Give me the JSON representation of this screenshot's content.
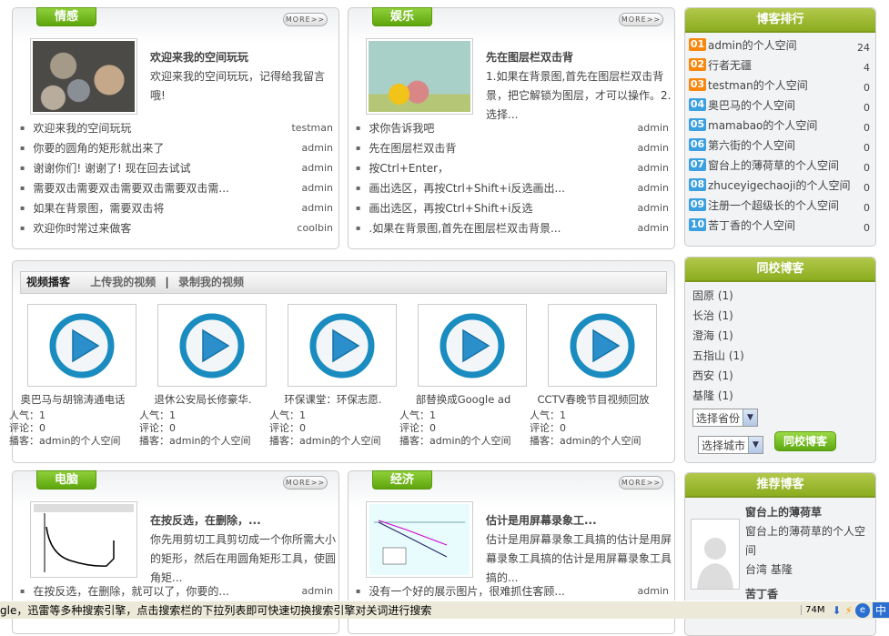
{
  "panels": [
    {
      "tab": "情感",
      "more": "MORE>>",
      "feature_title": "欢迎来我的空间玩玩",
      "feature_desc": "欢迎来我的空间玩玩，记得给我留言哦!",
      "items": [
        {
          "title": "欢迎来我的空间玩玩",
          "author": "testman"
        },
        {
          "title": "你要的圆角的矩形就出来了",
          "author": "admin"
        },
        {
          "title": "谢谢你们! 谢谢了! 现在回去试试",
          "author": "admin"
        },
        {
          "title": "需要双击需要双击需要双击需要双击需...",
          "author": "admin"
        },
        {
          "title": "如果在背景图，需要双击将",
          "author": "admin"
        },
        {
          "title": "欢迎你时常过来做客",
          "author": "coolbin"
        }
      ]
    },
    {
      "tab": "娱乐",
      "more": "MORE>>",
      "feature_title": "先在图层栏双击背",
      "feature_desc": "1.如果在背景图,首先在图层栏双击背景，把它解锁为图层，才可以操作。2.选择...",
      "items": [
        {
          "title": "求你告诉我吧",
          "author": "admin"
        },
        {
          "title": "先在图层栏双击背",
          "author": "admin"
        },
        {
          "title": "按Ctrl+Enter，",
          "author": "admin"
        },
        {
          "title": "画出选区，再按Ctrl+Shift+i反选画出...",
          "author": "admin"
        },
        {
          "title": "画出选区，再按Ctrl+Shift+i反选",
          "author": "admin"
        },
        {
          "title": ".如果在背景图,首先在图层栏双击背景...",
          "author": "admin"
        }
      ]
    },
    {
      "tab": "电脑",
      "more": "MORE>>",
      "feature_title": "在按反选，在删除，...",
      "feature_desc": "你先用剪切工具剪切成一个你所需大小的矩形，然后在用圆角矩形工具，使圆角矩...",
      "items": [
        {
          "title": "在按反选，在删除，就可以了，你要的...",
          "author": "admin"
        }
      ]
    },
    {
      "tab": "经济",
      "more": "MORE>>",
      "feature_title": "估计是用屏幕录象工...",
      "feature_desc": "估计是用屏幕录象工具搞的估计是用屏幕录象工具搞的估计是用屏幕录象工具搞的...",
      "items": [
        {
          "title": "没有一个好的展示图片，很难抓住客顾...",
          "author": "admin"
        }
      ]
    }
  ],
  "video": {
    "title": "视频播客",
    "upload": "上传我的视频",
    "sep": "|",
    "record": "录制我的视频",
    "items": [
      {
        "name": "奥巴马与胡锦涛通电话",
        "pop": "人气：1",
        "cmt": "评论：0",
        "author": "播客：admin的个人空间"
      },
      {
        "name": "退休公安局长修豪华.",
        "pop": "人气：1",
        "cmt": "评论：0",
        "author": "播客：admin的个人空间"
      },
      {
        "name": "环保课堂：环保志愿.",
        "pop": "人气：1",
        "cmt": "评论：0",
        "author": "播客：admin的个人空间"
      },
      {
        "name": "部替换成Google ad",
        "pop": "人气：1",
        "cmt": "评论：0",
        "author": "播客：admin的个人空间"
      },
      {
        "name": "CCTV春晚节目视频回放",
        "pop": "人气：1",
        "cmt": "评论：0",
        "author": "播客：admin的个人空间"
      }
    ]
  },
  "ranking": {
    "title": "博客排行",
    "items": [
      {
        "n": "01",
        "name": "admin的个人空间",
        "count": "24"
      },
      {
        "n": "02",
        "name": "行者无疆",
        "count": "4"
      },
      {
        "n": "03",
        "name": "testman的个人空间",
        "count": "0"
      },
      {
        "n": "04",
        "name": "奥巴马的个人空间",
        "count": "0"
      },
      {
        "n": "05",
        "name": "mamabao的个人空间",
        "count": "0"
      },
      {
        "n": "06",
        "name": "第六街的个人空间",
        "count": "0"
      },
      {
        "n": "07",
        "name": "窗台上的薄荷草的个人空间",
        "count": "0"
      },
      {
        "n": "08",
        "name": "zhuceyigechaoji的个人空间",
        "count": "0"
      },
      {
        "n": "09",
        "name": "注册一个超级长的个人空间",
        "count": "0"
      },
      {
        "n": "10",
        "name": "苦丁香的个人空间",
        "count": "0"
      }
    ]
  },
  "school": {
    "title": "同校博客",
    "items": [
      "固原 (1)",
      "长治 (1)",
      "澄海 (1)",
      "五指山 (1)",
      "西安 (1)",
      "基隆 (1)"
    ],
    "province": "选择省份",
    "city": "选择城市",
    "button": "同校博客"
  },
  "recommend": {
    "title": "推荐博客",
    "users": [
      {
        "name": "窗台上的薄荷草",
        "space": "窗台上的薄荷草的个人空间",
        "location": "台湾  基隆"
      },
      {
        "name": "苦丁香"
      }
    ]
  },
  "statusbar": {
    "text": "gle，迅雷等多种搜索引擎，点击搜索栏的下拉列表即可快速切换搜索引擎对关词进行搜索",
    "mem": "74M",
    "ime": "中"
  },
  "colors": {
    "green": "#6cb01a",
    "orange": "#f7870f",
    "blue": "#3ba0e0"
  }
}
